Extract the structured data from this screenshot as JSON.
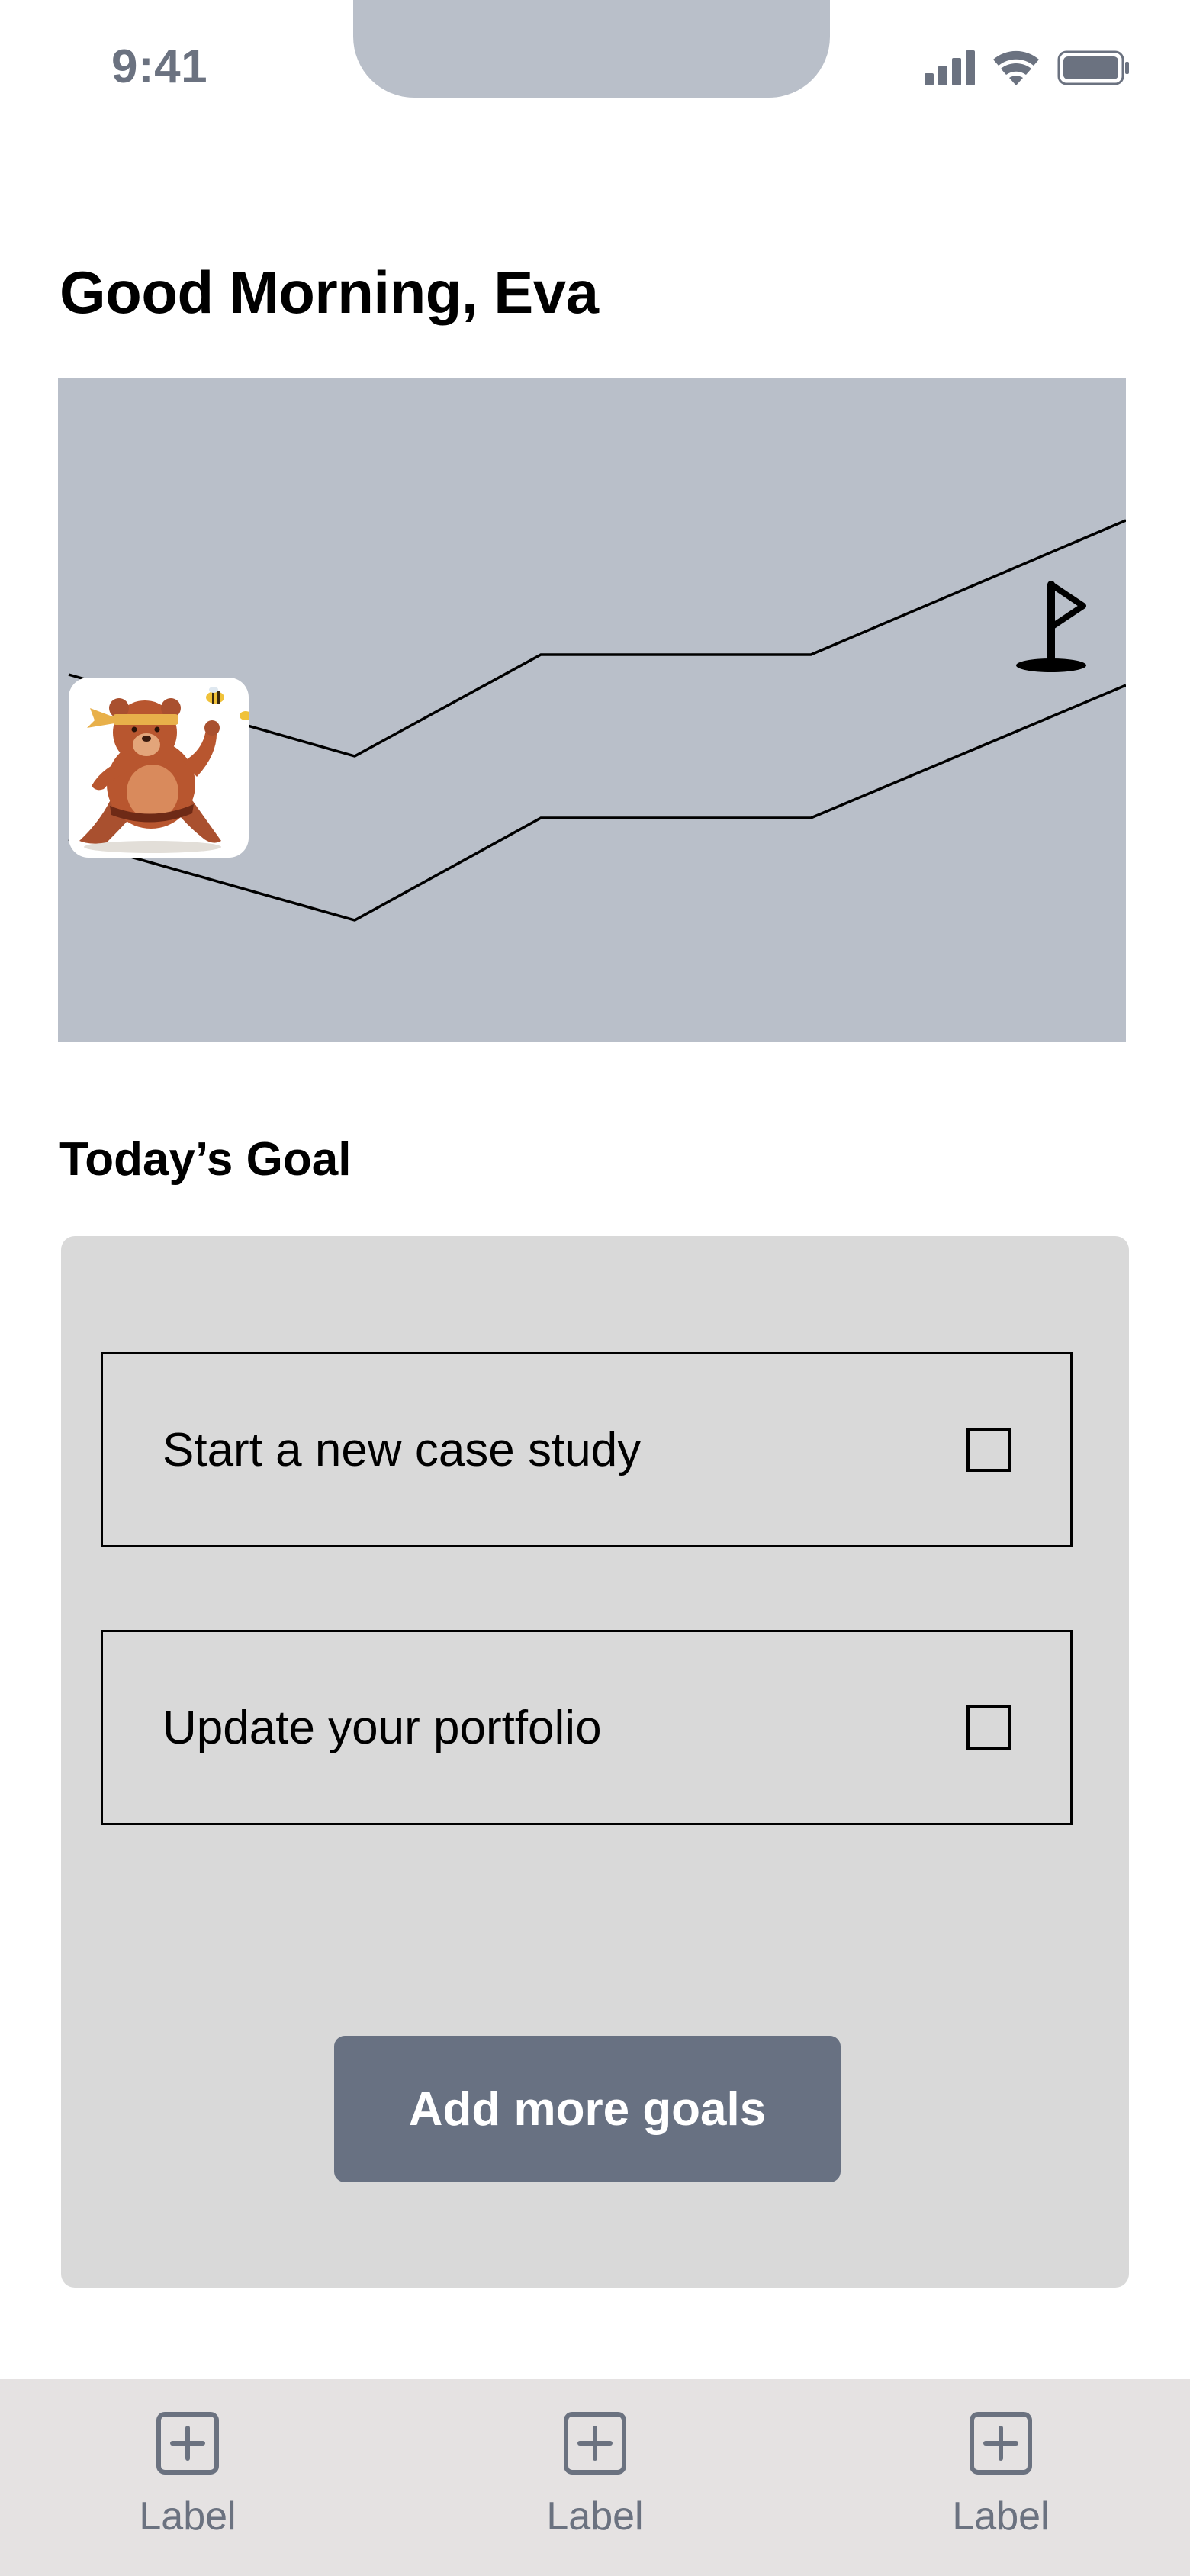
{
  "status_bar": {
    "time": "9:41"
  },
  "greeting": "Good Morning, Eva",
  "progress_map": {
    "avatar_icon": "bear-mascot",
    "goal_icon": "flag-icon"
  },
  "todays_goal": {
    "title": "Today’s  Goal",
    "goals": [
      {
        "label": "Start a new case study",
        "checked": false
      },
      {
        "label": "Update your portfolio",
        "checked": false
      }
    ],
    "add_button_label": "Add more goals"
  },
  "tab_bar": {
    "tabs": [
      {
        "label": "Label",
        "icon": "plus-square-icon"
      },
      {
        "label": "Label",
        "icon": "plus-square-icon"
      },
      {
        "label": "Label",
        "icon": "plus-square-icon"
      }
    ]
  },
  "colors": {
    "map_background": "#b9bfc9",
    "card_background": "#d9d9d9",
    "button_background": "#687182",
    "tab_bar_background": "#e5e2e2",
    "muted_text": "#6b7280"
  }
}
